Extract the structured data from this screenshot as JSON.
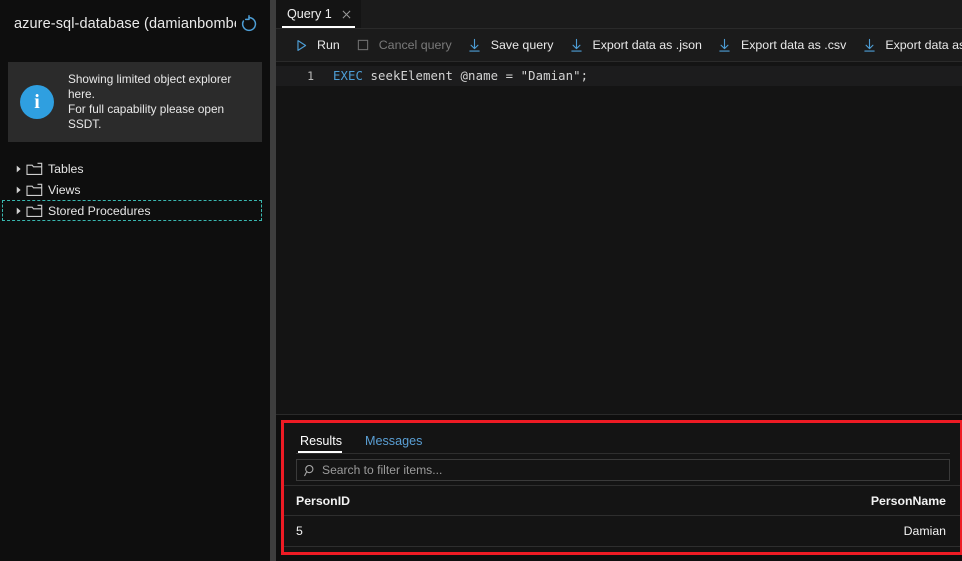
{
  "sidebar": {
    "title": "azure-sql-database (damianbombe…",
    "refresh_icon": "refresh-icon",
    "info": {
      "icon": "info-icon",
      "line1": "Showing limited object explorer here.",
      "line2": "For full capability please open SSDT."
    },
    "tree": [
      {
        "label": "Tables",
        "icon": "folder-icon",
        "expander": "chevron-right-icon",
        "focused": false
      },
      {
        "label": "Views",
        "icon": "folder-icon",
        "expander": "chevron-right-icon",
        "focused": false
      },
      {
        "label": "Stored Procedures",
        "icon": "folder-icon",
        "expander": "chevron-right-icon",
        "focused": true
      }
    ]
  },
  "editor_tab": {
    "label": "Query 1",
    "close_icon": "close-icon"
  },
  "toolbar": {
    "run": {
      "label": "Run",
      "icon": "play-icon",
      "disabled": false
    },
    "cancel": {
      "label": "Cancel query",
      "icon": "stop-square-icon",
      "disabled": true
    },
    "save": {
      "label": "Save query",
      "icon": "download-arrow-icon",
      "disabled": false
    },
    "export_json": {
      "label": "Export data as .json",
      "icon": "download-arrow-icon",
      "disabled": false
    },
    "export_csv": {
      "label": "Export data as .csv",
      "icon": "download-arrow-icon",
      "disabled": false
    },
    "export_xml": {
      "label": "Export data as .xml",
      "icon": "download-arrow-icon",
      "disabled": false
    }
  },
  "code": {
    "line_number": "1",
    "keyword": "EXEC",
    "rest": " seekElement @name = \"Damian\";"
  },
  "results": {
    "tabs": [
      {
        "label": "Results",
        "active": true
      },
      {
        "label": "Messages",
        "active": false
      }
    ],
    "filter": {
      "placeholder": "Search to filter items...",
      "value": "",
      "icon": "search-icon"
    },
    "columns": [
      "PersonID",
      "PersonName"
    ],
    "rows": [
      {
        "PersonID": "5",
        "PersonName": "Damian"
      }
    ],
    "highlight_color": "#ee1b24"
  },
  "colors": {
    "accent_blue": "#4d9ed6",
    "info_blue": "#2f9fe0",
    "focus_teal": "#39b8b0",
    "background": "#0e0e0e",
    "panel": "#141414"
  }
}
